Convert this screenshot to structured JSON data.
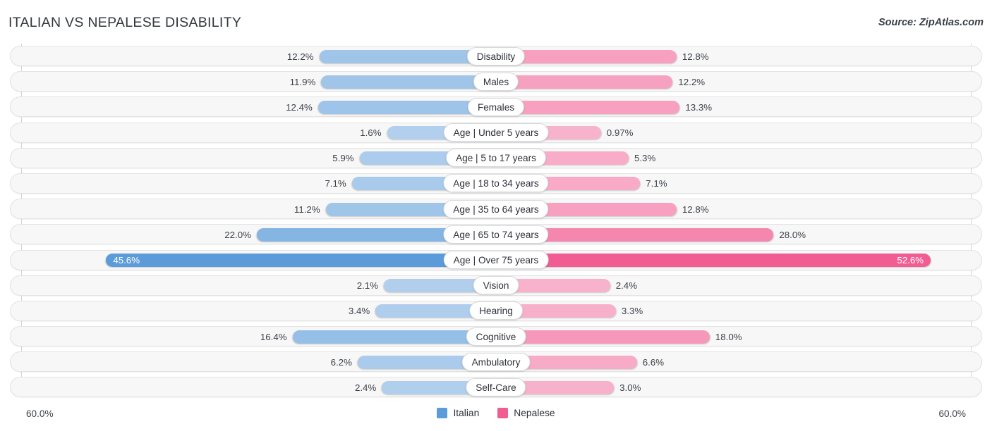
{
  "header": {
    "title": "ITALIAN VS NEPALESE DISABILITY",
    "source": "Source: ZipAtlas.com"
  },
  "axis": {
    "min_label": "60.0%",
    "max_label": "60.0%"
  },
  "legend": {
    "items": [
      {
        "label": "Italian",
        "color": "#5b9bd9"
      },
      {
        "label": "Nepalese",
        "color": "#f15d92"
      }
    ]
  },
  "colors": {
    "italian_base": "#5b9bd9",
    "nepalese_base": "#f15d92",
    "track": "#f7f7f7",
    "gridline": "#d2d3d5",
    "text": "#3d424a"
  },
  "chart_data": {
    "type": "bar",
    "title": "ITALIAN VS NEPALESE DISABILITY",
    "subtitle": "Source: ZipAtlas.com",
    "orientation": "horizontal-diverging",
    "xlabel": "",
    "ylabel": "",
    "xlim": [
      -60.0,
      60.0
    ],
    "axis_min_label": "60.0%",
    "axis_max_label": "60.0%",
    "grid": true,
    "legend_position": "bottom-center",
    "categories": [
      "Disability",
      "Males",
      "Females",
      "Age | Under 5 years",
      "Age | 5 to 17 years",
      "Age | 18 to 34 years",
      "Age | 35 to 64 years",
      "Age | 65 to 74 years",
      "Age | Over 75 years",
      "Vision",
      "Hearing",
      "Cognitive",
      "Ambulatory",
      "Self-Care"
    ],
    "series": [
      {
        "name": "Italian",
        "color": "#5b9bd9",
        "values": [
          12.2,
          11.9,
          12.4,
          1.6,
          5.9,
          7.1,
          11.2,
          22.0,
          45.6,
          2.1,
          3.4,
          16.4,
          6.2,
          2.4
        ],
        "labels": [
          "12.2%",
          "11.9%",
          "12.4%",
          "1.6%",
          "5.9%",
          "7.1%",
          "11.2%",
          "22.0%",
          "45.6%",
          "2.1%",
          "3.4%",
          "16.4%",
          "6.2%",
          "2.4%"
        ]
      },
      {
        "name": "Nepalese",
        "color": "#f15d92",
        "values": [
          12.8,
          12.2,
          13.3,
          0.97,
          5.3,
          7.1,
          12.8,
          28.0,
          52.6,
          2.4,
          3.3,
          18.0,
          6.6,
          3.0
        ],
        "labels": [
          "12.8%",
          "12.2%",
          "13.3%",
          "0.97%",
          "5.3%",
          "7.1%",
          "12.8%",
          "28.0%",
          "52.6%",
          "2.4%",
          "3.3%",
          "18.0%",
          "6.6%",
          "3.0%"
        ]
      }
    ]
  }
}
